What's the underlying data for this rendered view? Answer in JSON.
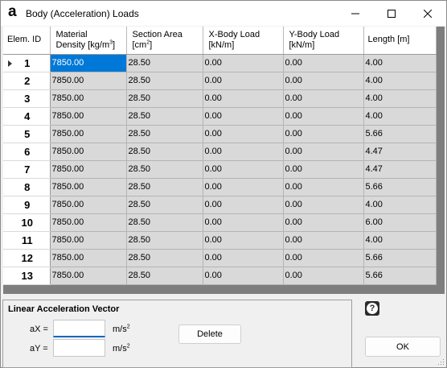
{
  "window": {
    "logo": "a",
    "title": "Body (Acceleration) Loads",
    "controls": {
      "minimize": "–",
      "maximize": "□",
      "close": "✕"
    }
  },
  "table": {
    "headers": {
      "elem_id": "Elem. ID",
      "density_line1": "Material",
      "density_line2": "Density [kg/m",
      "density_sup": "3",
      "density_end": "]",
      "area_line1": "Section Area",
      "area_line2": "[cm",
      "area_sup": "2",
      "area_end": "]",
      "xload_line1": "X-Body Load",
      "xload_line2": "[kN/m]",
      "yload_line1": "Y-Body Load",
      "yload_line2": "[kN/m]",
      "length": "Length [m]"
    },
    "rows": [
      {
        "id": "1",
        "density": "7850.00",
        "area": "28.50",
        "xload": "0.00",
        "yload": "0.00",
        "length": "4.00"
      },
      {
        "id": "2",
        "density": "7850.00",
        "area": "28.50",
        "xload": "0.00",
        "yload": "0.00",
        "length": "4.00"
      },
      {
        "id": "3",
        "density": "7850.00",
        "area": "28.50",
        "xload": "0.00",
        "yload": "0.00",
        "length": "4.00"
      },
      {
        "id": "4",
        "density": "7850.00",
        "area": "28.50",
        "xload": "0.00",
        "yload": "0.00",
        "length": "4.00"
      },
      {
        "id": "5",
        "density": "7850.00",
        "area": "28.50",
        "xload": "0.00",
        "yload": "0.00",
        "length": "5.66"
      },
      {
        "id": "6",
        "density": "7850.00",
        "area": "28.50",
        "xload": "0.00",
        "yload": "0.00",
        "length": "4.47"
      },
      {
        "id": "7",
        "density": "7850.00",
        "area": "28.50",
        "xload": "0.00",
        "yload": "0.00",
        "length": "4.47"
      },
      {
        "id": "8",
        "density": "7850.00",
        "area": "28.50",
        "xload": "0.00",
        "yload": "0.00",
        "length": "5.66"
      },
      {
        "id": "9",
        "density": "7850.00",
        "area": "28.50",
        "xload": "0.00",
        "yload": "0.00",
        "length": "4.00"
      },
      {
        "id": "10",
        "density": "7850.00",
        "area": "28.50",
        "xload": "0.00",
        "yload": "0.00",
        "length": "6.00"
      },
      {
        "id": "11",
        "density": "7850.00",
        "area": "28.50",
        "xload": "0.00",
        "yload": "0.00",
        "length": "4.00"
      },
      {
        "id": "12",
        "density": "7850.00",
        "area": "28.50",
        "xload": "0.00",
        "yload": "0.00",
        "length": "5.66"
      },
      {
        "id": "13",
        "density": "7850.00",
        "area": "28.50",
        "xload": "0.00",
        "yload": "0.00",
        "length": "5.66"
      }
    ],
    "selected_row": "1",
    "selected_column": "density"
  },
  "acceleration": {
    "group_title": "Linear Acceleration Vector",
    "ax_label": "aX =",
    "ay_label": "aY =",
    "ax_value": "",
    "ay_value": "",
    "unit": "m/s",
    "unit_sup": "2"
  },
  "buttons": {
    "delete": "Delete",
    "ok": "OK",
    "help": "?"
  },
  "colors": {
    "selection": "#0078d7",
    "cell_background": "#d9d9d9",
    "grid_background": "#7e7e7e"
  }
}
